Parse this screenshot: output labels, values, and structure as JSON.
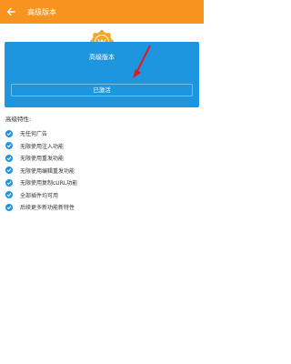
{
  "appbar": {
    "title": "高级版本",
    "back_icon": "arrow-left-icon"
  },
  "card": {
    "title": "高级版本",
    "badge_icon": "award-badge-icon",
    "button_label": "已激活"
  },
  "features": {
    "title": "高级特性:",
    "items": [
      "无任何广告",
      "无限使用注入功能",
      "无限使用重发功能",
      "无限使用编辑重发功能",
      "无限使用复制cURL功能",
      "全部插件均可用",
      "后续更多新功能新特性"
    ]
  },
  "colors": {
    "appbar": "#f7931e",
    "card": "#1e96df",
    "badge": "#f5a623",
    "arrow": "#e0191f"
  }
}
